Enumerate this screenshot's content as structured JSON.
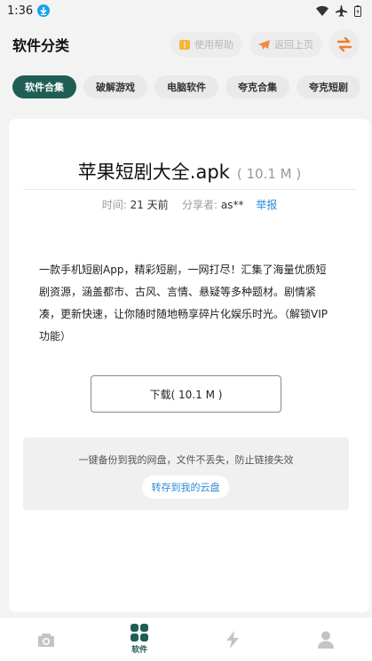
{
  "status_bar": {
    "time": "1:36"
  },
  "header": {
    "title": "软件分类",
    "help_label": "使用帮助",
    "back_label": "返回上页"
  },
  "tabs": [
    {
      "label": "软件合集",
      "active": true
    },
    {
      "label": "破解游戏",
      "active": false
    },
    {
      "label": "电脑软件",
      "active": false
    },
    {
      "label": "夸克合集",
      "active": false
    },
    {
      "label": "夸克短剧",
      "active": false
    }
  ],
  "file": {
    "name": "苹果短剧大全.apk",
    "size": "( 10.1 M )",
    "time_label": "时间:",
    "time_value": "21 天前",
    "sharer_label": "分享者:",
    "sharer_value": "as**",
    "report_label": "举报",
    "description": "一款手机短剧App，精彩短剧，一网打尽！汇集了海量优质短剧资源，涵盖都市、古风、言情、悬疑等多种题材。剧情紧凑，更新快速，让你随时随地畅享碎片化娱乐时光。（解锁VIP功能）",
    "download_label": "下载( 10.1 M )"
  },
  "backup": {
    "text": "一键备份到我的网盘，文件不丢失，防止链接失效",
    "button_label": "转存到我的云盘"
  },
  "bottom_nav": {
    "active_label": "软件"
  },
  "colors": {
    "accent": "#1f5e55",
    "link": "#2b8ad8",
    "swap_orange": "#f07d2a",
    "help_yellow": "#f5b63a",
    "back_orange": "#f08a45"
  }
}
